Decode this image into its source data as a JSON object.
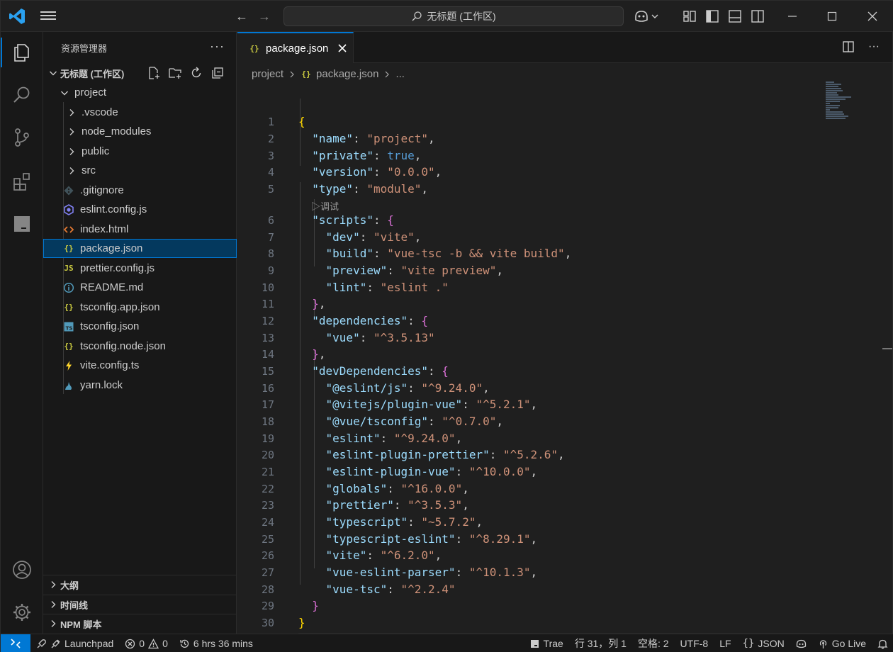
{
  "titlebar": {
    "search_text": "无标题 (工作区)"
  },
  "sidebar": {
    "title": "资源管理器",
    "more": "···",
    "workspace_label": "无标题 (工作区)",
    "project_folder": "project",
    "tree": [
      {
        "name": ".vscode",
        "type": "folder"
      },
      {
        "name": "node_modules",
        "type": "folder"
      },
      {
        "name": "public",
        "type": "folder"
      },
      {
        "name": "src",
        "type": "folder"
      },
      {
        "name": ".gitignore",
        "type": "file",
        "icon": "git-icon"
      },
      {
        "name": "eslint.config.js",
        "type": "file",
        "icon": "eslint-icon"
      },
      {
        "name": "index.html",
        "type": "file",
        "icon": "html-icon"
      },
      {
        "name": "package.json",
        "type": "file",
        "icon": "json-icon",
        "selected": true
      },
      {
        "name": "prettier.config.js",
        "type": "file",
        "icon": "js-icon"
      },
      {
        "name": "README.md",
        "type": "file",
        "icon": "info-icon"
      },
      {
        "name": "tsconfig.app.json",
        "type": "file",
        "icon": "json-icon"
      },
      {
        "name": "tsconfig.json",
        "type": "file",
        "icon": "ts-icon"
      },
      {
        "name": "tsconfig.node.json",
        "type": "file",
        "icon": "json-icon"
      },
      {
        "name": "vite.config.ts",
        "type": "file",
        "icon": "vite-icon"
      },
      {
        "name": "yarn.lock",
        "type": "file",
        "icon": "yarn-icon"
      }
    ],
    "sections": [
      "大纲",
      "时间线",
      "NPM 脚本"
    ]
  },
  "editor": {
    "tab_label": "package.json",
    "tab_icon": "{}",
    "breadcrumb": [
      "project",
      "package.json",
      "..."
    ],
    "codelens": "▷调试",
    "current_line": "31"
  },
  "statusbar": {
    "launchpad": "Launchpad",
    "errors": "0",
    "warnings": "0",
    "time": "6 hrs 36 mins",
    "trae": "Trae",
    "cursor_pos": "行 31，列 1",
    "spaces": "空格: 2",
    "encoding": "UTF-8",
    "eol": "LF",
    "language": "JSON",
    "go_live": "Go Live"
  },
  "colors": {
    "accent": "#0078d4",
    "key": "#9cdcfe",
    "string": "#ce9178",
    "boolean": "#569cd6",
    "bracket_outer": "#ffd700",
    "bracket_inner": "#da70d6"
  }
}
